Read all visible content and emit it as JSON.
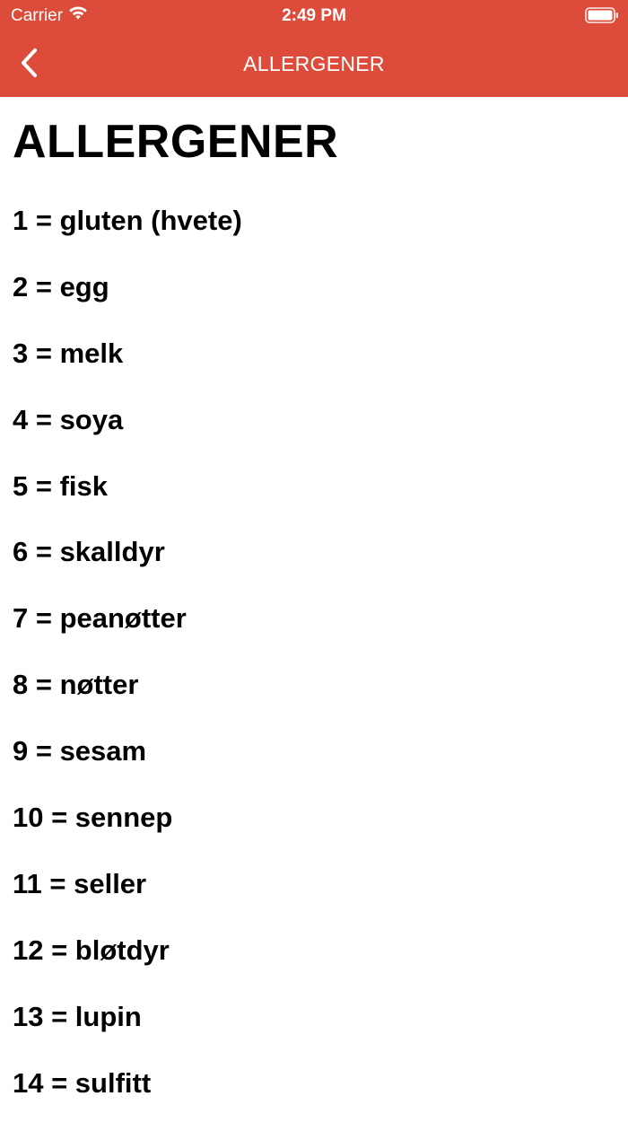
{
  "status_bar": {
    "carrier": "Carrier",
    "time": "2:49 PM"
  },
  "nav": {
    "title": "ALLERGENER"
  },
  "page": {
    "title": "ALLERGENER",
    "items": [
      "1 = gluten (hvete)",
      "2 = egg",
      "3 = melk",
      "4 = soya",
      "5 = fisk",
      "6 = skalldyr",
      "7 = peanøtter",
      "8 = nøtter",
      "9 = sesam",
      "10 = sennep",
      "11 = seller",
      "12 = bløtdyr",
      "13 = lupin",
      "14 = sulfitt"
    ]
  },
  "colors": {
    "accent": "#dd4b3a",
    "background": "#ffffff",
    "text": "#000000"
  },
  "icons": {
    "back": "chevron-left-icon",
    "wifi": "wifi-icon",
    "battery": "battery-icon"
  }
}
